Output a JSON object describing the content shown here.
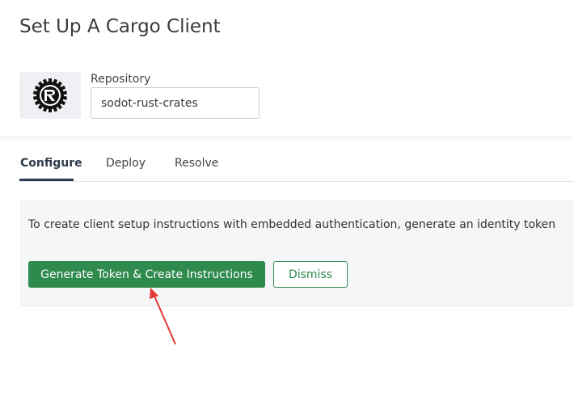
{
  "page": {
    "title": "Set Up A Cargo Client"
  },
  "repository": {
    "label": "Repository",
    "value": "sodot-rust-crates",
    "logo_icon": "rust-logo-icon"
  },
  "tabs": [
    {
      "label": "Configure",
      "active": true
    },
    {
      "label": "Deploy",
      "active": false
    },
    {
      "label": "Resolve",
      "active": false
    }
  ],
  "panel": {
    "message": "To create client setup instructions with embedded authentication, generate an identity token",
    "primary_button": "Generate Token & Create Instructions",
    "secondary_button": "Dismiss"
  },
  "colors": {
    "accent_green": "#2f8a4e",
    "tab_active": "#2e3b55",
    "annotation_arrow": "#e53935"
  }
}
